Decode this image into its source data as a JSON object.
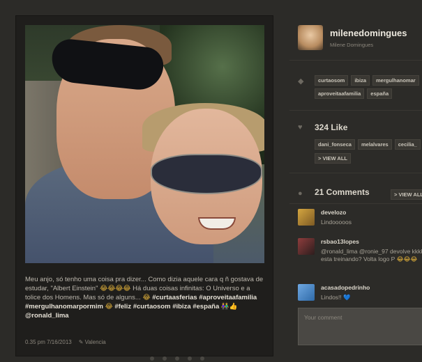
{
  "post": {
    "caption_text": "Meu anjo, só tenho uma coisa pra dizer... Como dizia aquele cara q ñ gostava de estudar, \"Albert Einstein\"",
    "caption_emoji_1": "😂😂😂😂",
    "caption_text_2": "Há duas coisas infinitas: O Universo e a tolice dos Homens. Mas só de alguns...",
    "caption_emoji_2": "😂",
    "caption_tags_1": "#curtaasferias #aproveitaafamilia #mergulhanomarpormim",
    "caption_emoji_3": "😂",
    "caption_tags_2": "#feliz #curtaosom #ibiza #españa",
    "caption_emoji_4": "👫👍",
    "caption_mention": "@ronald_lima",
    "time": "0.35 pm 7/16/2013",
    "edit_icon": "pencil-icon",
    "location": "Valencia"
  },
  "profile": {
    "username": "milenedomingues",
    "fullname": "Milene Domingues"
  },
  "tags": {
    "icon": "tag-icon",
    "items": [
      "curtaosom",
      "ibiza",
      "mergulhanomar",
      "aproveitaafamilia",
      "españa"
    ]
  },
  "likes": {
    "icon": "heart-icon",
    "label": "324 Like",
    "users": [
      "dani_fonseca",
      "melalvares",
      "cecilia_"
    ],
    "view_all": "> VIEW ALL"
  },
  "comments": {
    "icon": "comment-icon",
    "label": "21 Comments",
    "view_all": "> VIEW ALL",
    "items": [
      {
        "user": "develozo",
        "text": "Lindooooos",
        "emoji": ""
      },
      {
        "user": "rsbao13lopes",
        "text": "@ronald_lima @ronie_97 devolve kkkk esta treinando? Volta logo P",
        "emoji": "😂😂😂"
      },
      {
        "user": "acasadopedrinho",
        "text": "Lindos!!",
        "emoji": "💙"
      }
    ],
    "placeholder": "Your comment"
  }
}
